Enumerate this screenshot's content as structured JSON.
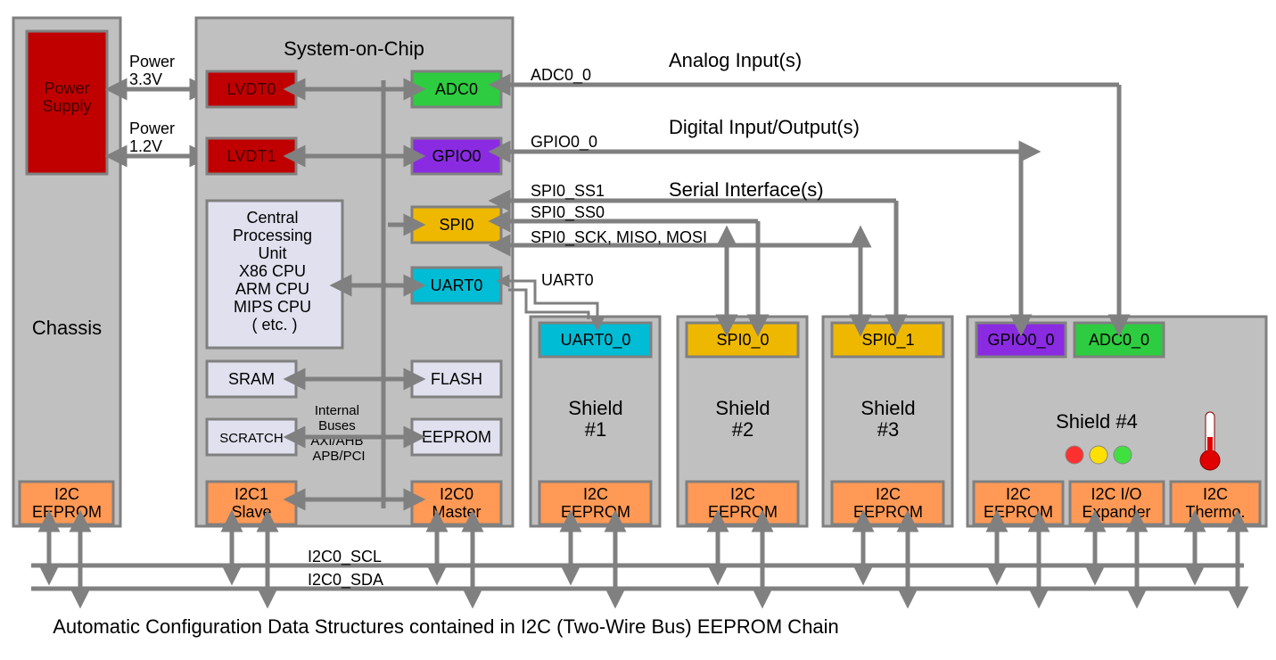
{
  "chassis": {
    "label": "Chassis",
    "power_supply": "Power\nSupply",
    "eeprom": "I2C\nEEPROM"
  },
  "power": {
    "p33": "Power\n3.3V",
    "p12": "Power\n1.2V"
  },
  "soc": {
    "title": "System-on-Chip",
    "lvdt0": "LVDT0",
    "lvdt1": "LVDT1",
    "cpu": "Central\nProcessing\nUnit\nX86 CPU\nARM CPU\nMIPS CPU\n( etc. )",
    "sram": "SRAM",
    "scratch": "SCRATCH",
    "bus_label": "Internal\nBuses\nAXI/AHB\nAPB/PCI",
    "adc0": "ADC0",
    "gpio0": "GPIO0",
    "spi0": "SPI0",
    "uart0": "UART0",
    "flash": "FLASH",
    "eeprom": "EEPROM",
    "i2c1": "I2C1\nSlave",
    "i2c0": "I2C0\nMaster"
  },
  "signals": {
    "adc0_0": "ADC0_0",
    "analog": "Analog Input(s)",
    "gpio0_0": "GPIO0_0",
    "digital": "Digital Input/Output(s)",
    "spi0_ss1": "SPI0_SS1",
    "serial": "Serial Interface(s)",
    "spi0_ss0": "SPI0_SS0",
    "spi_bus": "SPI0_SCK, MISO, MOSI",
    "uart0": "UART0",
    "i2c_scl": "I2C0_SCL",
    "i2c_sda": "I2C0_SDA"
  },
  "shields": {
    "s1": {
      "label": "Shield\n#1",
      "port": "UART0_0",
      "eeprom": "I2C\nEEPROM"
    },
    "s2": {
      "label": "Shield\n#2",
      "port": "SPI0_0",
      "eeprom": "I2C\nEEPROM"
    },
    "s3": {
      "label": "Shield\n#3",
      "port": "SPI0_1",
      "eeprom": "I2C\nEEPROM"
    },
    "s4": {
      "label": "Shield  #4",
      "gpio": "GPIO0_0",
      "adc": "ADC0_0",
      "eeprom": "I2C\nEEPROM",
      "ioexp": "I2C I/O\nExpander",
      "thermo": "I2C\nThermo."
    }
  },
  "footer": "Automatic Configuration Data Structures contained in I2C (Two-Wire Bus) EEPROM Chain"
}
